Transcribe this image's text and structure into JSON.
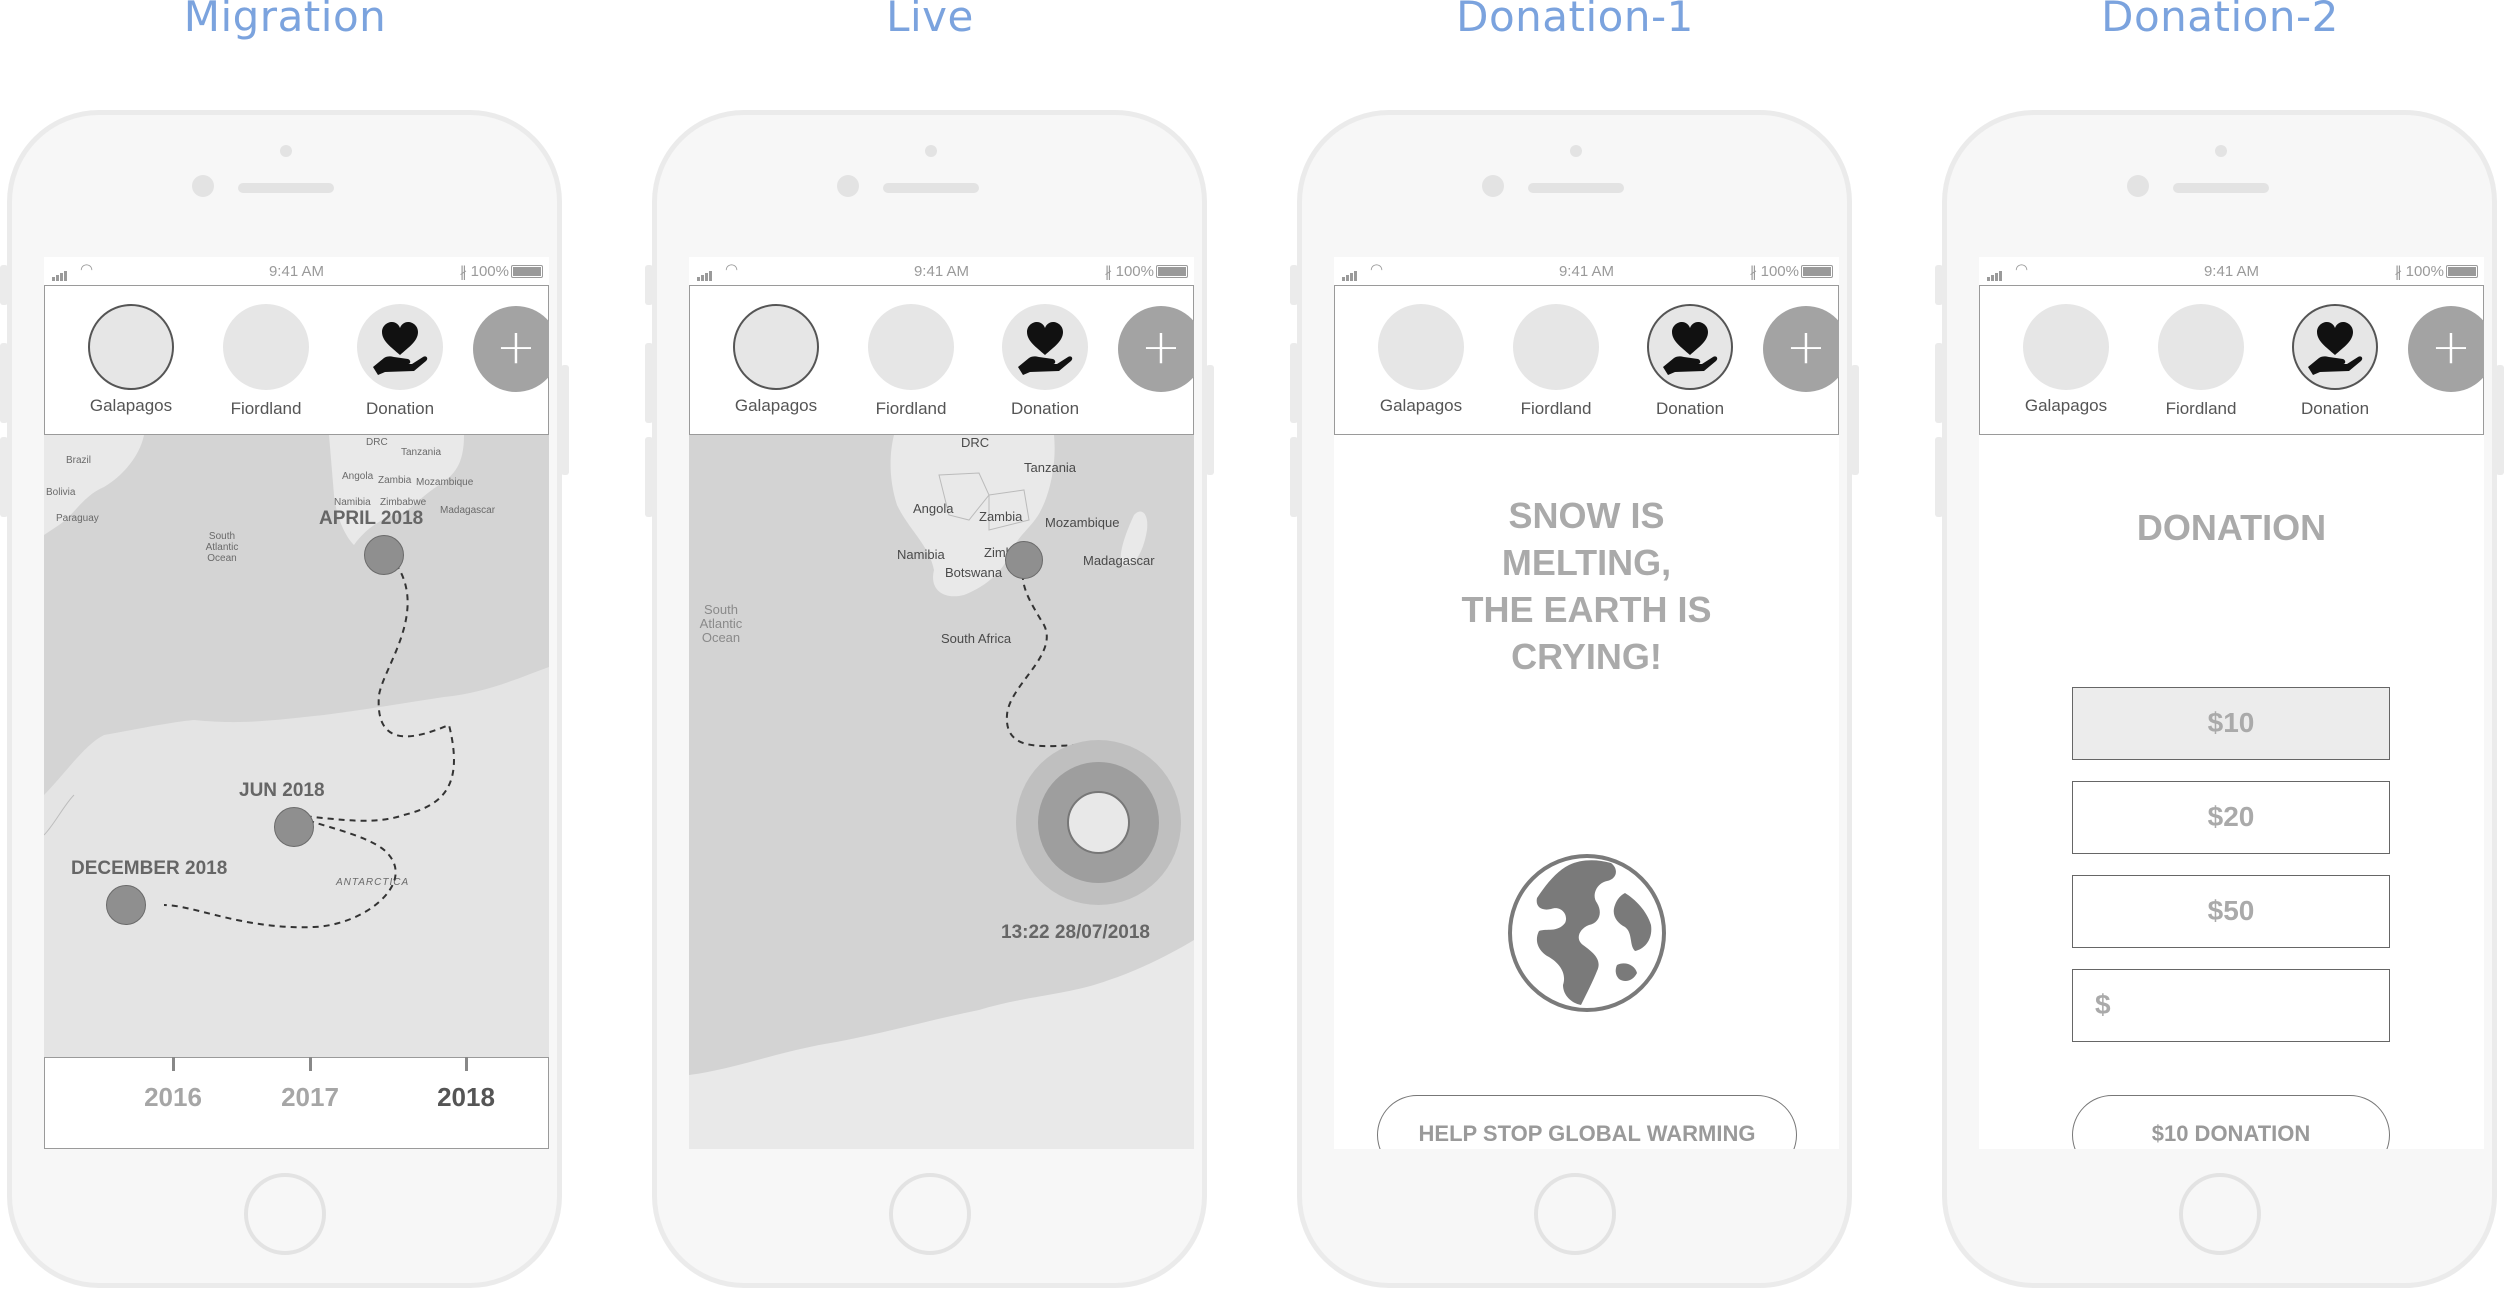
{
  "frames": [
    {
      "title": "Migration"
    },
    {
      "title": "Live"
    },
    {
      "title": "Donation-1"
    },
    {
      "title": "Donation-2"
    }
  ],
  "status_bar": {
    "time": "9:41 AM",
    "battery": "100%"
  },
  "tabs": [
    {
      "label": "Galapagos"
    },
    {
      "label": "Fiordland"
    },
    {
      "label": "Donation"
    }
  ],
  "add_icon": "plus-icon",
  "donation_icon": "heart-in-hand-icon",
  "migration": {
    "points": [
      {
        "label": "APRIL 2018"
      },
      {
        "label": "JUN 2018"
      },
      {
        "label": "DECEMBER 2018"
      }
    ],
    "map_labels": [
      "DRC",
      "Tanzania",
      "Angola",
      "Zambia",
      "Mozambique",
      "Namibia",
      "Zimbabwe",
      "Madagascar",
      "Brazil",
      "Paraguay",
      "Bolivia",
      "South Atlantic Ocean",
      "ANTARCTICA"
    ],
    "timeline": {
      "years": [
        "2016",
        "2017",
        "2018"
      ],
      "active_year": "2018"
    }
  },
  "live": {
    "map_labels": {
      "drc": "DRC",
      "tanzania": "Tanzania",
      "angola": "Angola",
      "zambia": "Zambia",
      "mozambique": "Mozambique",
      "namibia": "Namibia",
      "zim": "Zimb",
      "botswana": "Botswana",
      "madagascar": "Madagascar",
      "south_africa": "South Africa",
      "ocean": "South Atlantic Ocean"
    },
    "timestamp": "13:22  28/07/2018"
  },
  "donation1": {
    "headline": [
      "SNOW IS",
      "MELTING,",
      "THE EARTH IS",
      "CRYING!"
    ],
    "globe_icon": "globe-icon",
    "cta": "HELP STOP GLOBAL WARMING"
  },
  "donation2": {
    "heading": "DONATION",
    "options": [
      "$10",
      "$20",
      "$50"
    ],
    "selected_option": "$10",
    "custom_placeholder": "$",
    "submit": "$10  DONATION"
  }
}
